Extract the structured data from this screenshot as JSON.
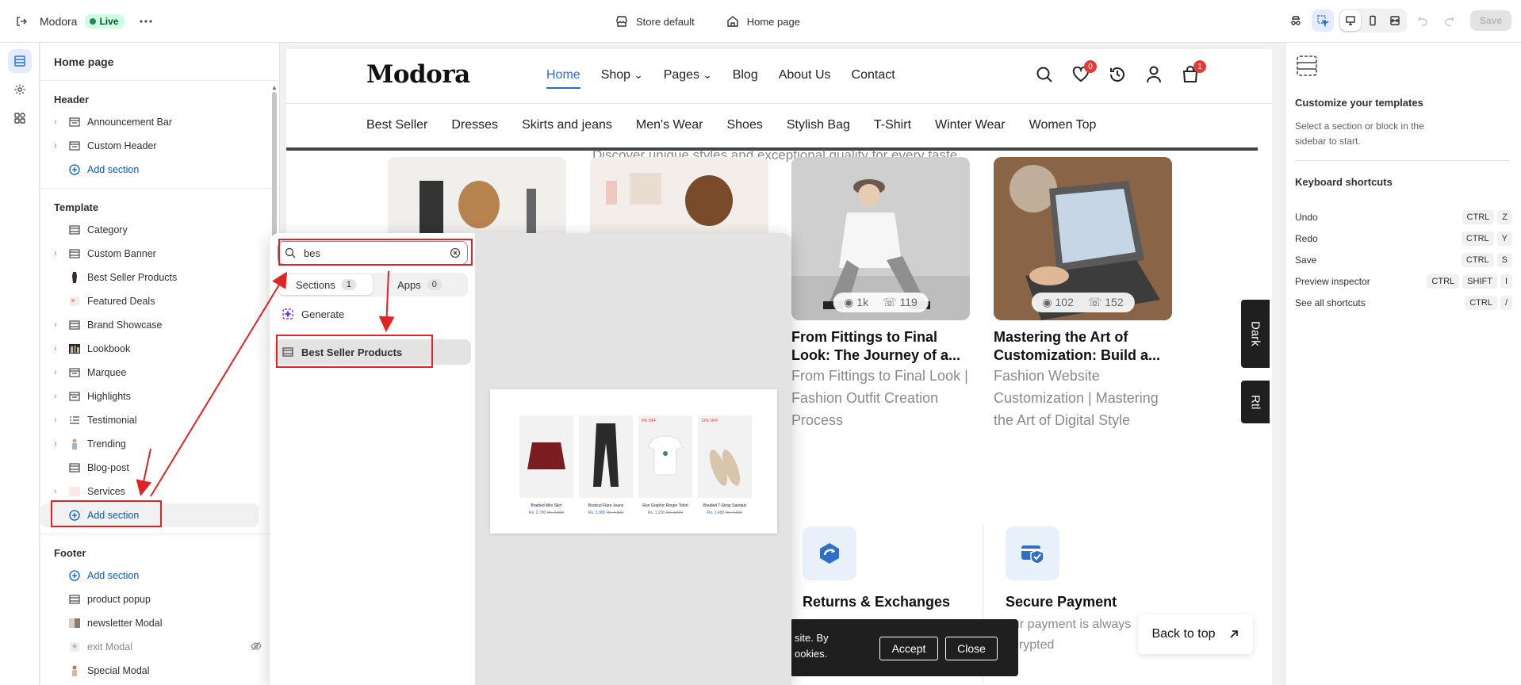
{
  "topbar": {
    "brand": "Modora",
    "status": "Live",
    "store": "Store default",
    "page": "Home page",
    "save": "Save"
  },
  "sidebar": {
    "title": "Home page",
    "header_group": {
      "title": "Header",
      "items": [
        "Announcement Bar",
        "Custom Header"
      ],
      "add": "Add section"
    },
    "template_group": {
      "title": "Template",
      "items": [
        "Category",
        "Custom Banner",
        "Best Seller Products",
        "Featured Deals",
        "Brand Showcase",
        "Lookbook",
        "Marquee",
        "Highlights",
        "Testimonial",
        "Trending",
        "Blog-post",
        "Services"
      ],
      "add": "Add section"
    },
    "footer_group": {
      "title": "Footer",
      "add": "Add section",
      "items": [
        "product popup",
        "newsletter Modal",
        "exit Modal",
        "Special Modal"
      ]
    }
  },
  "popover": {
    "search_value": "bes",
    "tabs": [
      {
        "label": "Sections",
        "count": "1"
      },
      {
        "label": "Apps",
        "count": "0"
      }
    ],
    "generate": "Generate",
    "result": "Best Seller Products",
    "preview_products": [
      {
        "name": "Braided Mini Skirt",
        "price": "Rs. 2,700",
        "old": "Rs. 3,000",
        "tag": ""
      },
      {
        "name": "Bootcut Flare Jeans",
        "price": "Rs. 3,900",
        "old": "Rs. 4,500",
        "tag": ""
      },
      {
        "name": "Run Graphic Ringer Tshirt",
        "price": "Rs. 1,200",
        "old": "Rs. 1,500",
        "tag": "9% OFF"
      },
      {
        "name": "Braided T-Strap Sandals",
        "price": "Rs. 1,400",
        "old": "Rs. 1,600",
        "tag": "13% OFF"
      }
    ]
  },
  "store": {
    "logo": "Modora",
    "nav": [
      "Home",
      "Shop",
      "Pages",
      "Blog",
      "About Us",
      "Contact"
    ],
    "wishlist_count": "0",
    "cart_count": "1",
    "categories": [
      "Best Seller",
      "Dresses",
      "Skirts and jeans",
      "Men's Wear",
      "Shoes",
      "Stylish Bag",
      "T-Shirt",
      "Winter Wear",
      "Women Top"
    ],
    "tagline": "Discover unique styles and exceptional quality for every taste.",
    "blogs": [
      {
        "views": "1k",
        "comments": "119",
        "title": "From Fittings to Final Look: The Journey of a...",
        "sub": "From Fittings to Final Look | Fashion Outfit Creation Process"
      },
      {
        "views": "102",
        "comments": "152",
        "title": "Mastering the Art of Customization: Build a...",
        "sub": "Fashion Website Customization | Mastering the Art of Digital Style"
      }
    ],
    "features": [
      {
        "title": "Returns & Exchanges",
        "sub": ""
      },
      {
        "title": "Secure Payment",
        "sub1": "our payment is always",
        "sub2": "ncrypted"
      }
    ],
    "dark_tab": "Dark",
    "rtl_tab": "Rtl",
    "back_to_top": "Back to top",
    "cookie": {
      "line1": "site. By",
      "line2": "ookies.",
      "accept": "Accept",
      "close": "Close"
    }
  },
  "rpanel": {
    "title": "Customize your templates",
    "desc": "Select a section or block in the sidebar to start.",
    "shortcuts_title": "Keyboard shortcuts",
    "shortcuts": [
      {
        "label": "Undo",
        "keys": [
          "CTRL",
          "Z"
        ]
      },
      {
        "label": "Redo",
        "keys": [
          "CTRL",
          "Y"
        ]
      },
      {
        "label": "Save",
        "keys": [
          "CTRL",
          "S"
        ]
      },
      {
        "label": "Preview inspector",
        "keys": [
          "CTRL",
          "SHIFT",
          "I"
        ]
      },
      {
        "label": "See all shortcuts",
        "keys": [
          "CTRL",
          "/"
        ]
      }
    ]
  },
  "colors": {
    "accent": "#005bd3",
    "live_bg": "#cdfee1",
    "annotation": "#e02424",
    "store_link": "#2a6bd1"
  }
}
